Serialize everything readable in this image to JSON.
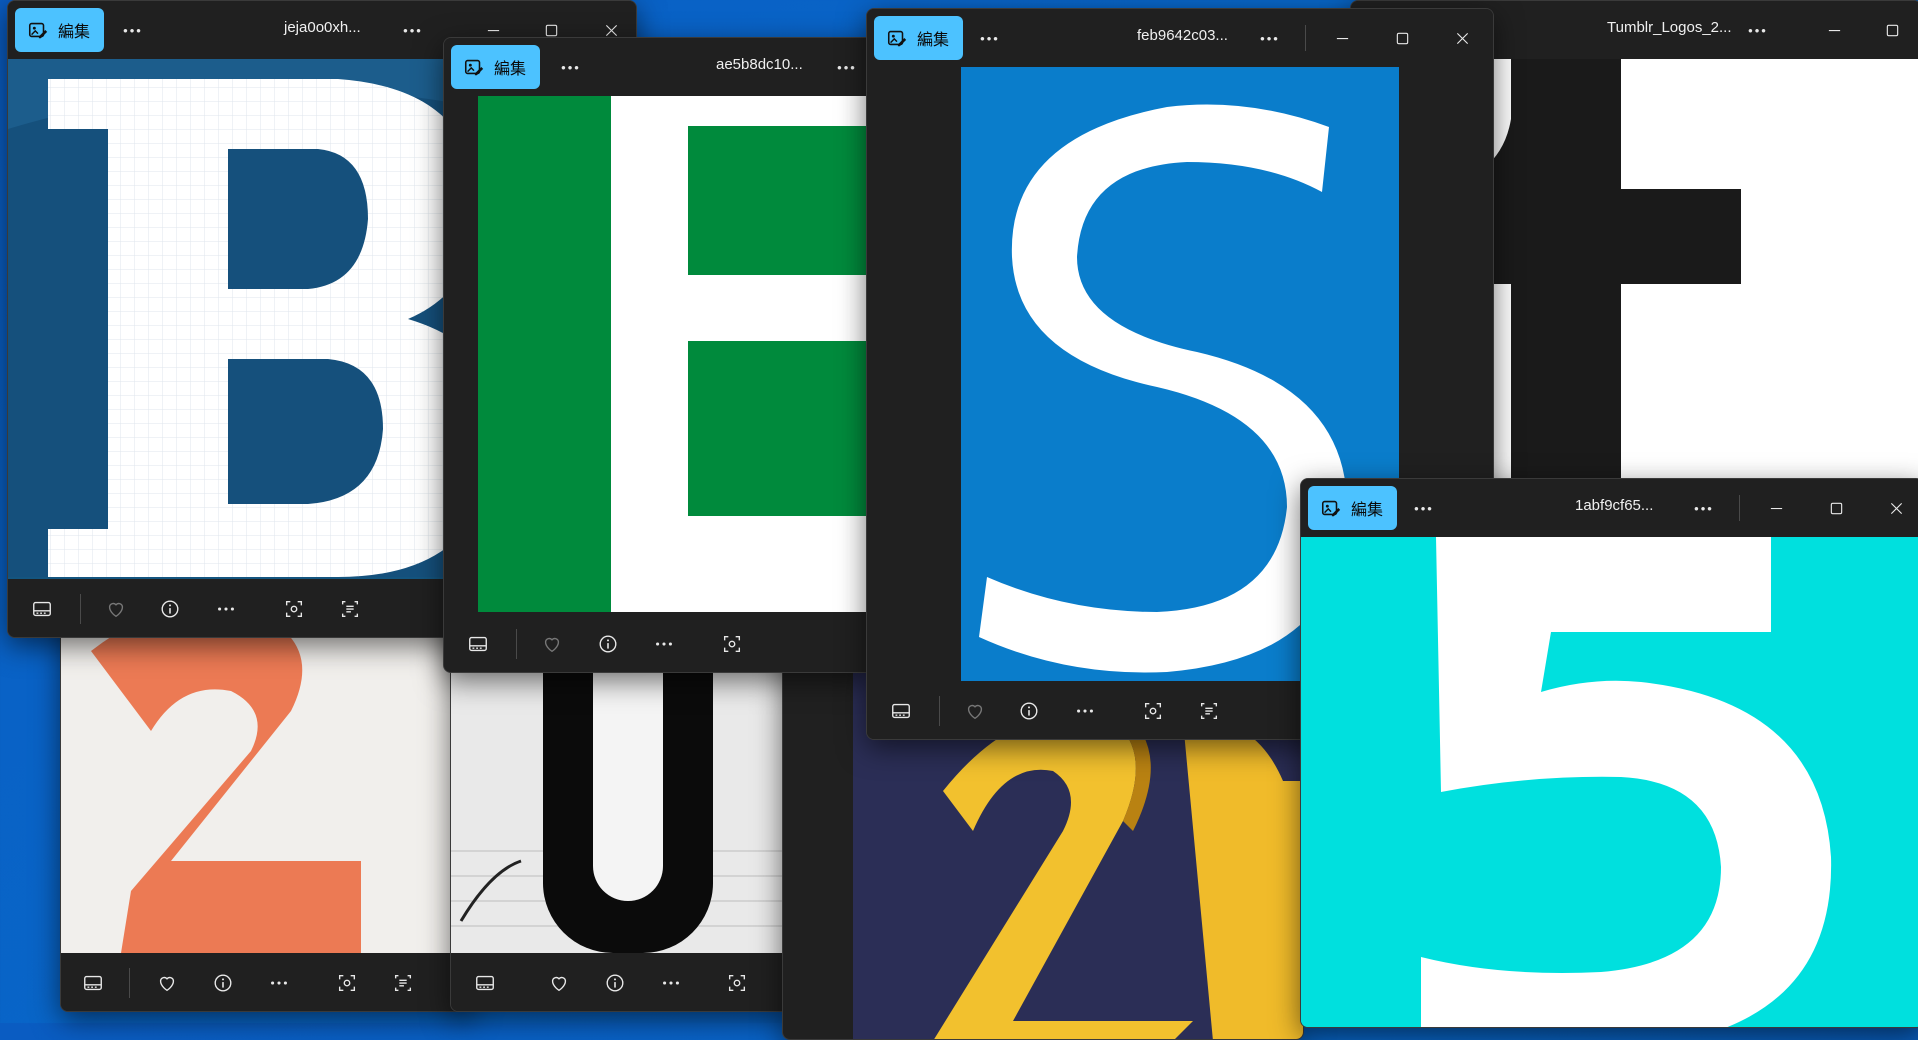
{
  "edit_label": "編集",
  "windows": {
    "w1": {
      "title": "jeja0o0xh..."
    },
    "w2": {
      "title": "ae5b8dc10..."
    },
    "w3": {
      "title": "feb9642c03..."
    },
    "w4": {
      "title": "Tumblr_Logos_2..."
    },
    "w5": {
      "title": "1abf9cf65..."
    }
  },
  "colors": {
    "edit_accent": "#4cc2ff",
    "chrome": "#202020",
    "green_tile": "#008a3c",
    "blue_tile": "#0a7dcb",
    "cyan_tile": "#00e0de",
    "navy_letter": "#154f7a"
  },
  "icons": [
    "edit-photo-icon",
    "more-icon",
    "minimize-icon",
    "maximize-icon",
    "close-icon",
    "filmstrip-icon",
    "heart-icon",
    "info-icon",
    "crop-icon",
    "text-scan-icon"
  ]
}
